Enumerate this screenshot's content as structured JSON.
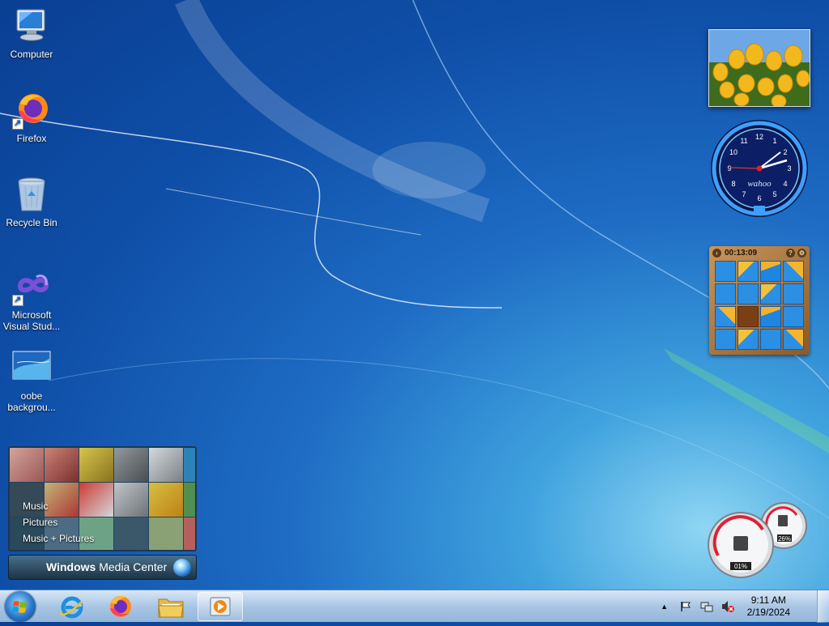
{
  "desktop": {
    "icons": [
      {
        "label": "Computer"
      },
      {
        "label": "Firefox"
      },
      {
        "label": "Recycle Bin"
      },
      {
        "label": "Microsoft Visual Stud..."
      },
      {
        "label": "oobe backgrou..."
      }
    ]
  },
  "gadgets": {
    "clock": {
      "brand": "wahoo",
      "numerals": [
        "12",
        "1",
        "2",
        "3",
        "4",
        "5",
        "6",
        "7",
        "8",
        "9",
        "10",
        "11"
      ]
    },
    "puzzle": {
      "timer": "00:13:09",
      "help": "?"
    },
    "meter": {
      "cpu": "01%",
      "memory": "26%"
    }
  },
  "media_center": {
    "menu": [
      "Music",
      "Pictures",
      "Music + Pictures"
    ],
    "brand_bold": "Windows",
    "brand_light": "Media Center"
  },
  "taskbar": {
    "clock_time": "9:11 AM",
    "clock_date": "2/19/2024",
    "tray_arrow": "▲"
  },
  "colors": {
    "accent": "#1e6cc4",
    "taskbar": "#a9c6e4"
  }
}
